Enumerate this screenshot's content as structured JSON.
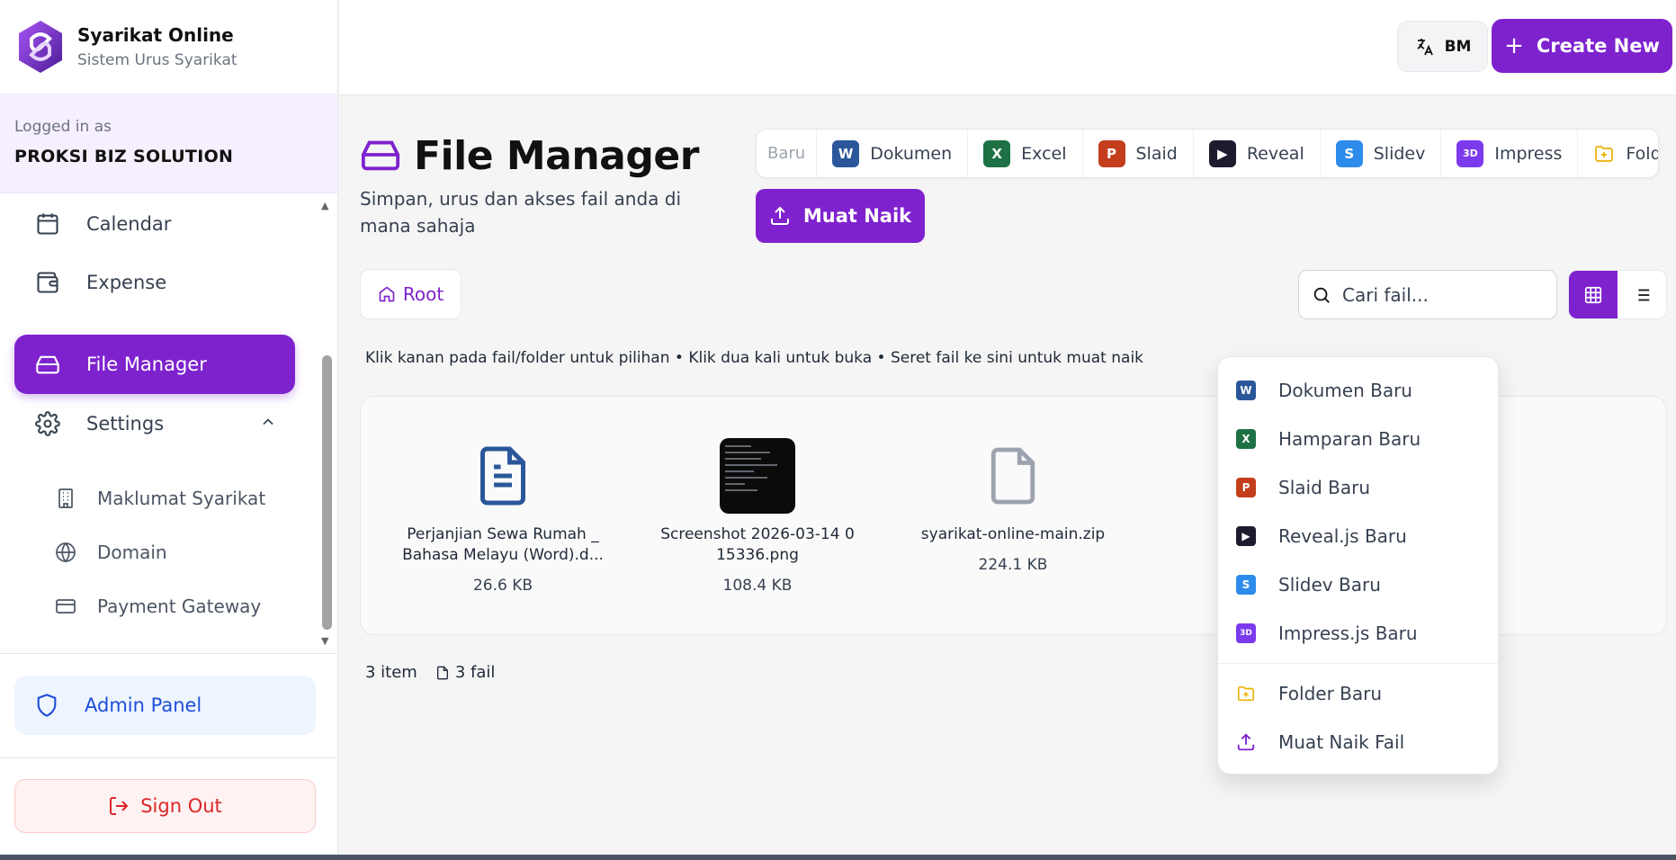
{
  "brand": {
    "title": "Syarikat Online",
    "subtitle": "Sistem Urus Syarikat"
  },
  "session": {
    "logged_label": "Logged in as",
    "company": "PROKSI BIZ SOLUTION"
  },
  "sidebar": {
    "items": [
      {
        "label": "Calendar",
        "icon": "calendar-icon"
      },
      {
        "label": "Expense",
        "icon": "wallet-icon"
      },
      {
        "label": "File Manager",
        "icon": "hard-drive-icon",
        "active": true
      },
      {
        "label": "Settings",
        "icon": "gear-icon",
        "expanded": true
      }
    ],
    "sub_items": [
      {
        "label": "Maklumat Syarikat",
        "icon": "building-icon"
      },
      {
        "label": "Domain",
        "icon": "globe-icon"
      },
      {
        "label": "Payment Gateway",
        "icon": "credit-card-icon"
      }
    ],
    "admin_label": "Admin Panel",
    "signout_label": "Sign Out"
  },
  "topbar": {
    "lang_label": "BM",
    "create_label": "Create New"
  },
  "page": {
    "title": "File Manager",
    "subtitle": "Simpan, urus dan akses fail anda di mana sahaja",
    "new_label": "Baru",
    "new_items": [
      {
        "label": "Dokumen",
        "badge": "W"
      },
      {
        "label": "Excel",
        "badge": "X"
      },
      {
        "label": "Slaid",
        "badge": "P"
      },
      {
        "label": "Reveal",
        "badge": "▶"
      },
      {
        "label": "Slidev",
        "badge": "S"
      },
      {
        "label": "Impress",
        "badge": "3D"
      },
      {
        "label": "Folder",
        "badge": "folder-plus-icon"
      }
    ],
    "upload_label": "Muat Naik",
    "breadcrumb": "Root",
    "search_placeholder": "Cari fail...",
    "hint": "Klik kanan pada fail/folder untuk pilihan • Klik dua kali untuk buka • Seret fail ke sini untuk muat naik",
    "files": [
      {
        "name": "Perjanjian Sewa Rumah _ Bahasa Melayu (Word).d...",
        "size": "26.6 KB",
        "type": "document"
      },
      {
        "name": "Screenshot 2026-03-14 0 15336.png",
        "size": "108.4 KB",
        "type": "image"
      },
      {
        "name": "syarikat-online-main.zip",
        "size": "224.1 KB",
        "type": "zip"
      }
    ],
    "summary": {
      "items": "3 item",
      "files": "3 fail"
    }
  },
  "context_menu": {
    "items": [
      {
        "label": "Dokumen Baru",
        "badge": "W"
      },
      {
        "label": "Hamparan Baru",
        "badge": "X"
      },
      {
        "label": "Slaid Baru",
        "badge": "P"
      },
      {
        "label": "Reveal.js Baru",
        "badge": "▶"
      },
      {
        "label": "Slidev Baru",
        "badge": "S"
      },
      {
        "label": "Impress.js Baru",
        "badge": "3D"
      },
      {
        "label": "Folder Baru",
        "icon": "folder-plus-icon"
      },
      {
        "label": "Muat Naik Fail",
        "icon": "upload-icon"
      }
    ]
  },
  "colors": {
    "accent": "#7e22ce",
    "word": "#2b579a",
    "excel": "#1e7145",
    "powerpoint": "#c43e1c",
    "reveal": "#1f1b2e",
    "slidev": "#2d8ceb",
    "impress": "#7c3aed",
    "folder": "#eab308",
    "danger": "#dc2626",
    "admin": "#1d4ed8"
  }
}
